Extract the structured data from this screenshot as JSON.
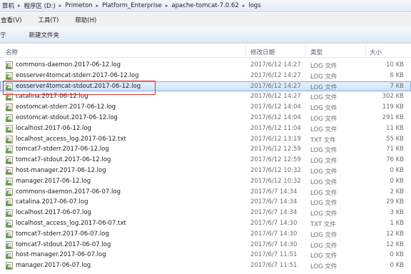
{
  "breadcrumb": [
    "算机",
    "程序区 (D:)",
    "Primeton",
    "Platform_Enterprise",
    "apache-tomcat-7.0.62",
    "logs"
  ],
  "menu": [
    "查看(V)",
    "工具(T)",
    "帮助(H)"
  ],
  "toolbar": {
    "left_fragment": "亍",
    "new_folder": "新建文件夹"
  },
  "columns": {
    "name": "名称",
    "date": "修改日期",
    "type": "类型",
    "size": "大小"
  },
  "files": [
    {
      "name": "commons-daemon.2017-06-12.log",
      "date": "2017/6/12 14:27",
      "type": "LOG 文件",
      "size": "10 KB"
    },
    {
      "name": "eosserver4tomcat-stderr.2017-06-12.log",
      "date": "2017/6/12 14:27",
      "type": "LOG 文件",
      "size": "6 KB"
    },
    {
      "name": "eosserver4tomcat-stdout.2017-06-12.log",
      "date": "2017/6/12 14:27",
      "type": "LOG 文件",
      "size": "7 KB"
    },
    {
      "name": "catalina.2017-06-12.log",
      "date": "2017/6/12 14:27",
      "type": "LOG 文件",
      "size": "302 KB"
    },
    {
      "name": "eostomcat-stderr.2017-06-12.log",
      "date": "2017/6/12 14:04",
      "type": "LOG 文件",
      "size": "119 KB"
    },
    {
      "name": "eostomcat-stdout.2017-06-12.log",
      "date": "2017/6/12 14:04",
      "type": "LOG 文件",
      "size": "291 KB"
    },
    {
      "name": "localhost.2017-06-12.log",
      "date": "2017/6/12 11:04",
      "type": "LOG 文件",
      "size": "11 KB"
    },
    {
      "name": "localhost_access_log.2017-06-12.txt",
      "date": "2017/6/12 13:19",
      "type": "TXT 文件",
      "size": "55 KB"
    },
    {
      "name": "tomcat7-stderr.2017-06-12.log",
      "date": "2017/6/12 12:59",
      "type": "LOG 文件",
      "size": "71 KB"
    },
    {
      "name": "tomcat7-stdout.2017-06-12.log",
      "date": "2017/6/12 12:59",
      "type": "LOG 文件",
      "size": "76 KB"
    },
    {
      "name": "host-manager.2017-06-12.log",
      "date": "2017/6/12 10:32",
      "type": "LOG 文件",
      "size": "0 KB"
    },
    {
      "name": "manager.2017-06-12.log",
      "date": "2017/6/12 10:32",
      "type": "LOG 文件",
      "size": "0 KB"
    },
    {
      "name": "commons-daemon.2017-06-07.log",
      "date": "2017/6/7 14:34",
      "type": "LOG 文件",
      "size": "2 KB"
    },
    {
      "name": "catalina.2017-06-07.log",
      "date": "2017/6/7 14:34",
      "type": "LOG 文件",
      "size": "29 KB"
    },
    {
      "name": "localhost.2017-06-07.log",
      "date": "2017/6/7 14:34",
      "type": "LOG 文件",
      "size": "3 KB"
    },
    {
      "name": "localhost_access_log.2017-06-07.txt",
      "date": "2017/6/7 14:30",
      "type": "TXT 文件",
      "size": "1 KB"
    },
    {
      "name": "tomcat7-stderr.2017-06-07.log",
      "date": "2017/6/7 14:30",
      "type": "LOG 文件",
      "size": "12 KB"
    },
    {
      "name": "tomcat7-stdout.2017-06-07.log",
      "date": "2017/6/7 14:30",
      "type": "LOG 文件",
      "size": "12 KB"
    },
    {
      "name": "host-manager.2017-06-07.log",
      "date": "2017/6/7 11:51",
      "type": "LOG 文件",
      "size": "0 KB"
    },
    {
      "name": "manager.2017-06-07.log",
      "date": "2017/6/7 11:51",
      "type": "LOG 文件",
      "size": "0 KB"
    }
  ],
  "selected_index": 2,
  "colors": {
    "highlight_border": "#e03030",
    "selection": "#cce2f9"
  }
}
